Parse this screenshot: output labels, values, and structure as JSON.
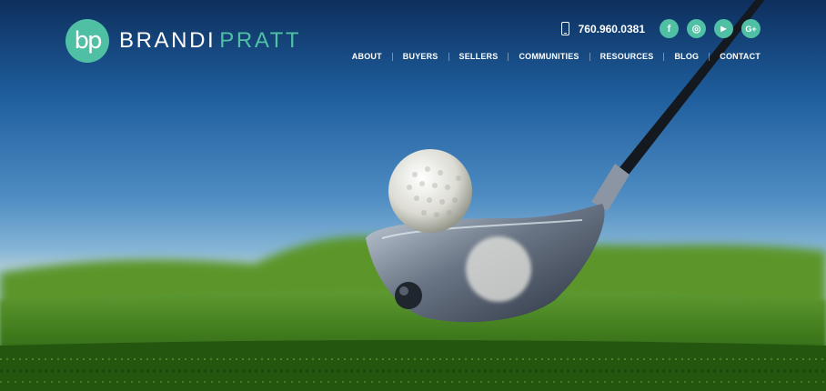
{
  "brand": {
    "monogram": "bp",
    "first_name": "BRANDI",
    "last_name": "PRATT",
    "accent_color": "#4fc0a4"
  },
  "contact": {
    "phone_icon": "phone-icon",
    "phone": "760.960.0381"
  },
  "social": [
    {
      "icon": "facebook-icon",
      "glyph": "f"
    },
    {
      "icon": "instagram-icon",
      "glyph": "◎"
    },
    {
      "icon": "youtube-icon",
      "glyph": "▶"
    },
    {
      "icon": "google-plus-icon",
      "glyph": "G+"
    }
  ],
  "nav": {
    "items": [
      "ABOUT",
      "BUYERS",
      "SELLERS",
      "COMMUNITIES",
      "RESOURCES",
      "BLOG",
      "CONTACT"
    ]
  }
}
